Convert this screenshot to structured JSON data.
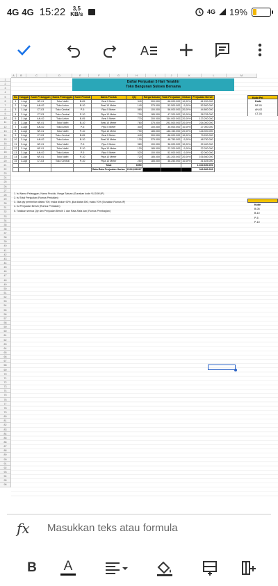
{
  "status": {
    "signal1": "4G",
    "signal2": "4G",
    "time": "15:22",
    "speed_value": "3,5",
    "speed_unit": "KB/s",
    "network": "4G",
    "battery_text": "19%",
    "battery_level": 0.19
  },
  "toolbar": {
    "icons": [
      "check-icon",
      "undo-icon",
      "redo-icon",
      "text-format-icon",
      "add-icon",
      "comment-icon",
      "more-icon"
    ]
  },
  "sheet": {
    "columns": [
      "A",
      "B",
      "C",
      "D",
      "E",
      "F",
      "G",
      "H",
      "I",
      "J",
      "K",
      "L",
      "M"
    ],
    "row_count": 96,
    "title_line1": "Daftar Penjualan 5 Hari Terakhir",
    "title_line2": "Toko Bangunan Sukses Bersama",
    "headers": [
      "No",
      "Tanggal",
      "Kode Pelanggan",
      "Nama Pelanggan",
      "Kode Produk",
      "Nama Produk",
      "Qty",
      "Harga Satuan",
      "Total Penjualan",
      "Diskon",
      "Penjualan Bersih"
    ],
    "rows": [
      [
        "1",
        "1-Agt",
        "NF-01",
        "Toko Nafiri",
        "B-05",
        "Besi 5 Meter",
        "340",
        "200.000",
        "68.000.000",
        "10,00%",
        "61.200.000"
      ],
      [
        "2",
        "1-Agt",
        "AN-02",
        "Toko Anton",
        "B-10",
        "Besi 10 Meter",
        "140",
        "375.000",
        "52.500.000",
        "0,00%",
        "52.500.000"
      ],
      [
        "3",
        "1-Agt",
        "CT-03",
        "Toko Central",
        "P-5",
        "Pipa 5 Meter",
        "560",
        "100.000",
        "56.000.000",
        "20,00%",
        "44.800.000"
      ],
      [
        "4",
        "2-Agt",
        "CT-03",
        "Toko Central",
        "P-10",
        "Pipa 10 Meter",
        "730",
        "185.000",
        "47.200.000",
        "10,00%",
        "38.705.000"
      ],
      [
        "5",
        "2-Agt",
        "AN-02",
        "Toko Anton",
        "B-05",
        "Besi 5 Meter",
        "770",
        "200.000",
        "154.000.000",
        "20,00%",
        "123.200.000"
      ],
      [
        "6",
        "2-Agt",
        "NF-01",
        "Toko Nafiri",
        "B-10",
        "Besi 10 Meter",
        "780",
        "375.000",
        "292.500.000",
        "20,00%",
        "234.000.000"
      ],
      [
        "7",
        "2-Agt",
        "AN-02",
        "Toko Anton",
        "P-5",
        "Pipa 5 Meter",
        "300",
        "100.000",
        "30.000.000",
        "10,00%",
        "27.000.000"
      ],
      [
        "8",
        "2-Agt",
        "NF-01",
        "Toko Nafiri",
        "P-10",
        "Pipa 10 Meter",
        "790",
        "185.000",
        "146.150.000",
        "20,00%",
        "116.920.000"
      ],
      [
        "9",
        "2-Agt",
        "CT-03",
        "Toko Central",
        "B-05",
        "Besi 5 Meter",
        "440",
        "200.000",
        "88.000.000",
        "10,00%",
        "79.200.000"
      ],
      [
        "10",
        "2-Agt",
        "AN-02",
        "Toko Anton",
        "B-10",
        "Besi 10 Meter",
        "130",
        "375.000",
        "48.750.000",
        "0,00%",
        "48.750.000"
      ],
      [
        "11",
        "3-Agt",
        "NF-01",
        "Toko Nafiri",
        "P-5",
        "Pipa 5 Meter",
        "360",
        "100.000",
        "36.000.000",
        "10,00%",
        "32.400.000"
      ],
      [
        "12",
        "3-Agt",
        "NF-01",
        "Toko Nafiri",
        "P-10",
        "Pipa 10 Meter",
        "120",
        "185.000",
        "22.200.000",
        "0,00%",
        "22.200.000"
      ],
      [
        "13",
        "3-Agt",
        "AN-02",
        "Toko Anton",
        "P-5",
        "Pipa 5 Meter",
        "520",
        "100.000",
        "52.000.000",
        "0,00%",
        "52.000.000"
      ],
      [
        "14",
        "3-Agt",
        "NF-01",
        "Toko Nafiri",
        "P-10",
        "Pipa 10 Meter",
        "720",
        "185.000",
        "133.200.000",
        "20,00%",
        "106.560.000"
      ],
      [
        "15",
        "3-Agt",
        "CT-03",
        "Toko Central",
        "P-10",
        "Pipa 10 Meter",
        "250",
        "185.000",
        "46.250.000",
        "10,00%",
        "41.625.000"
      ]
    ],
    "total_label": "Total",
    "total_qty": "6950",
    "total_net": "1.040.650.000",
    "avg_label": "Rata-Rata Penjualan Harian",
    "avg_qty": "2016,666667",
    "avg_net": "346.883.333",
    "notes": [
      "1. Isi Nama Pelanggan, Nama Produk, Harga Satuan (Gunakan kode VLOOKUP)",
      "2. Isi Total Penjualan (Rumus Perkalian)",
      "3. Jika qty pembelian diatas 700, maka diskon 92%, jika diatas 500, maka 70% (Gunakan Rumus IF)",
      "4. Isi Penjualan Bersih (Rumus Perkalian)",
      "5. Totalkan semua Qty dan Penjualan Bersih 1 dan Rata-Rata kan (Rumus Pembagian)"
    ],
    "side1_header": "Kode Pel",
    "side1_header2": "Kode",
    "side1_items": [
      "NF-01",
      "AN-02",
      "CT-03"
    ],
    "side2_header": "Kode",
    "side2_items": [
      "B-05",
      "B-10",
      "P-5",
      "P-10"
    ]
  },
  "formula": {
    "placeholder": "Masukkan teks atau formula"
  },
  "format": {
    "bold": "B",
    "text_color_letter": "A"
  }
}
